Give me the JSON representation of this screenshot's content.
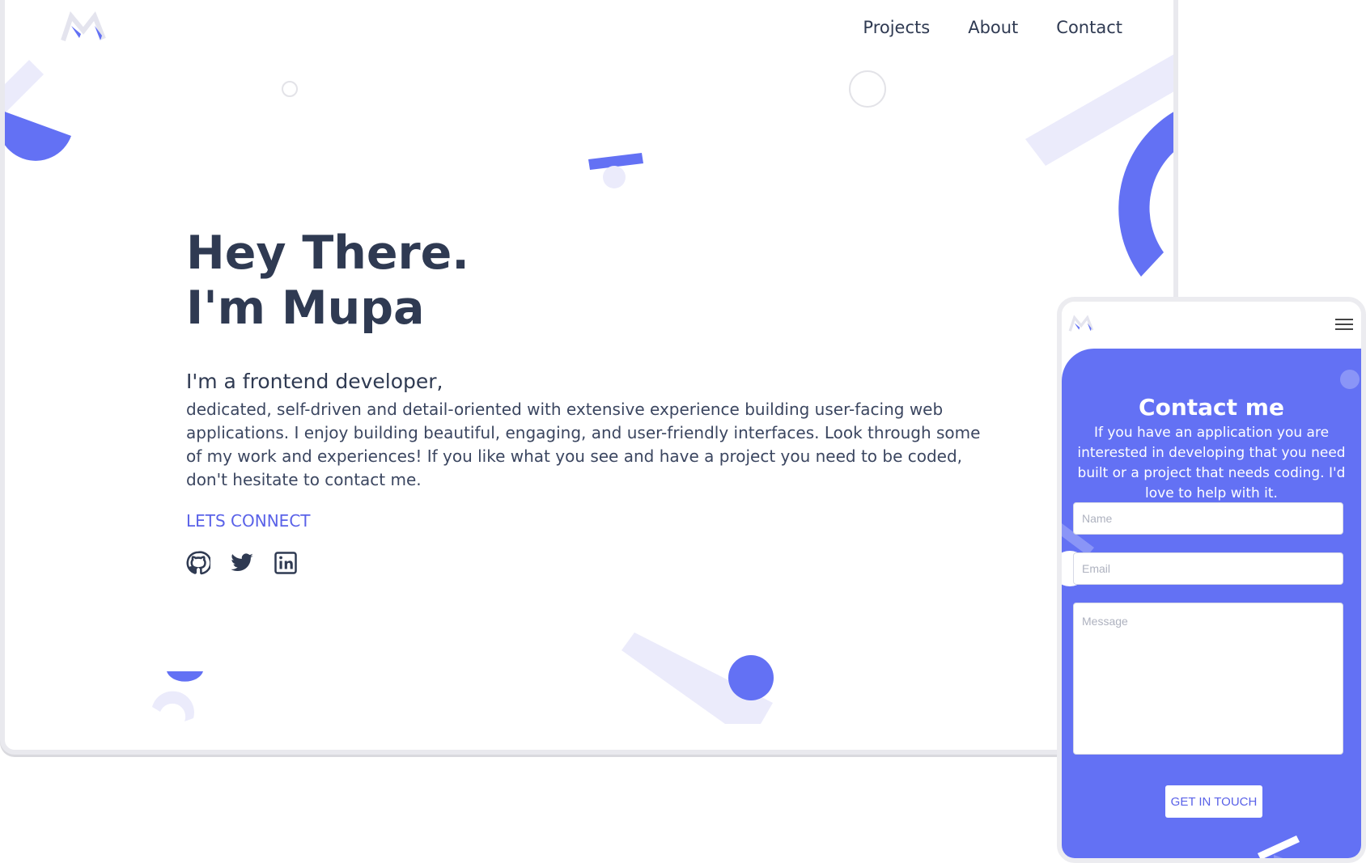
{
  "nav": {
    "items": [
      "Projects",
      "About",
      "Contact"
    ]
  },
  "hero": {
    "title_line1": "Hey There.",
    "title_line2": "I'm Mupa",
    "subheading": "I'm a frontend developer,",
    "bio": "dedicated, self-driven and detail-oriented with extensive experience building user-facing web applications. I enjoy building beautiful, engaging, and user-friendly interfaces. Look through some of my work and experiences! If you like what you see and have a project you need to be coded, don't hesitate to contact me.",
    "cta": "LETS CONNECT"
  },
  "socials": [
    "github-icon",
    "twitter-icon",
    "linkedin-icon"
  ],
  "mobile": {
    "contact_title": "Contact me",
    "contact_desc": "If you have an application you are interested in developing that you need built or a project that needs coding. I'd love to help with it.",
    "name_placeholder": "Name",
    "email_placeholder": "Email",
    "message_placeholder": "Message",
    "submit": "GET IN TOUCH"
  },
  "colors": {
    "accent": "#6371f4",
    "accent_light": "#ebebfb",
    "text": "#2f3a52"
  }
}
